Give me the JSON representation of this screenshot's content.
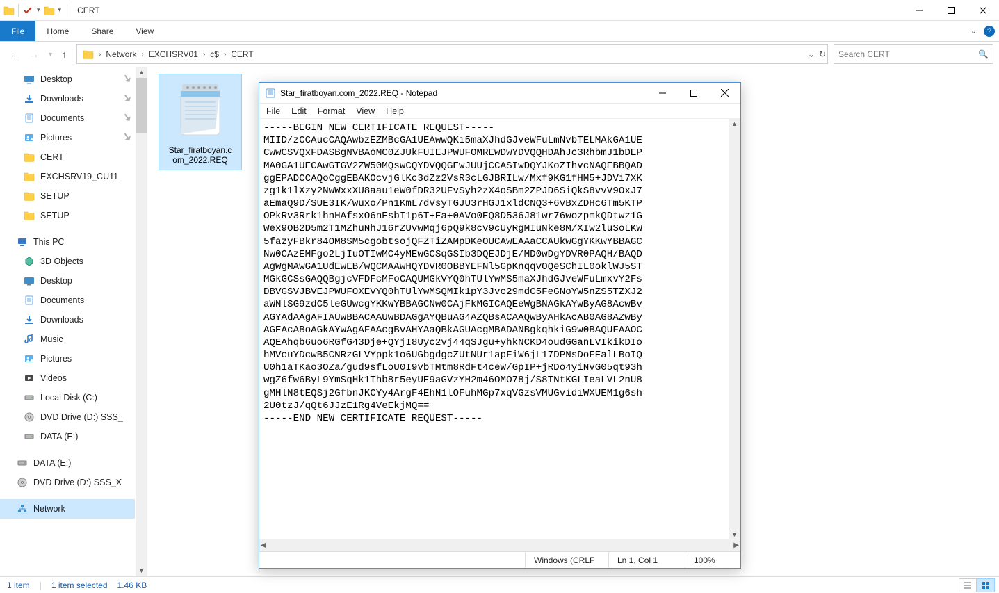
{
  "titlebar": {
    "title": "CERT"
  },
  "ribbon": {
    "file": "File",
    "home": "Home",
    "share": "Share",
    "view": "View"
  },
  "address": {
    "segments": [
      "Network",
      "EXCHSRV01",
      "c$",
      "CERT"
    ]
  },
  "search": {
    "placeholder": "Search CERT"
  },
  "nav": {
    "quick": [
      {
        "label": "Desktop",
        "icon": "desktop",
        "pin": true
      },
      {
        "label": "Downloads",
        "icon": "downloads",
        "pin": true
      },
      {
        "label": "Documents",
        "icon": "documents",
        "pin": true
      },
      {
        "label": "Pictures",
        "icon": "pictures",
        "pin": true
      },
      {
        "label": "CERT",
        "icon": "folder"
      },
      {
        "label": "EXCHSRV19_CU11",
        "icon": "folder"
      },
      {
        "label": "SETUP",
        "icon": "folder"
      },
      {
        "label": "SETUP",
        "icon": "folder"
      }
    ],
    "thispc_label": "This PC",
    "thispc": [
      {
        "label": "3D Objects",
        "icon": "3d"
      },
      {
        "label": "Desktop",
        "icon": "desktop"
      },
      {
        "label": "Documents",
        "icon": "documents"
      },
      {
        "label": "Downloads",
        "icon": "downloads"
      },
      {
        "label": "Music",
        "icon": "music"
      },
      {
        "label": "Pictures",
        "icon": "pictures"
      },
      {
        "label": "Videos",
        "icon": "videos"
      },
      {
        "label": "Local Disk (C:)",
        "icon": "drive"
      },
      {
        "label": "DVD Drive (D:) SSS_",
        "icon": "dvd"
      },
      {
        "label": "DATA (E:)",
        "icon": "drive"
      }
    ],
    "extra": [
      {
        "label": "DATA (E:)",
        "icon": "drive"
      },
      {
        "label": "DVD Drive (D:) SSS_X",
        "icon": "dvd"
      }
    ],
    "network_label": "Network"
  },
  "file": {
    "name_line1": "Star_firatboyan.c",
    "name_line2": "om_2022.REQ"
  },
  "status": {
    "count": "1 item",
    "selected": "1 item selected",
    "size": "1.46 KB"
  },
  "notepad": {
    "title": "Star_firatboyan.com_2022.REQ - Notepad",
    "menu": {
      "file": "File",
      "edit": "Edit",
      "format": "Format",
      "view": "View",
      "help": "Help"
    },
    "body": "-----BEGIN NEW CERTIFICATE REQUEST-----\nMIID/zCCAucCAQAwbzEZMBcGA1UEAwwQKi5maXJhdGJveWFuLmNvbTELMAkGA1UE\nCwwCSVQxFDASBgNVBAoMC0ZJUkFUIEJPWUFOMREwDwYDVQQHDAhJc3RhbmJ1bDEP\nMA0GA1UECAwGTGV2ZW50MQswCQYDVQQGEwJUUjCCASIwDQYJKoZIhvcNAQEBBQAD\nggEPADCCAQoCggEBAKOcvjGlKc3dZz2VsR3cLGJBRILw/Mxf9KG1fHM5+JDVi7XK\nzg1k1lXzy2NwWxxXU8aau1eW0fDR32UFvSyh2zX4oSBm2ZPJD6SiQkS8vvV9OxJ7\naEmaQ9D/SUE3IK/wuxo/Pn1KmL7dVsyTGJU3rHGJ1xldCNQ3+6vBxZDHc6Tm5KTP\nOPkRv3Rrk1hnHAfsxO6nEsbI1p6T+Ea+0AVo0EQ8D536J81wr76wozpmkQDtwz1G\nWex9OB2D5m2T1MZhuNhJ16rZUvwMqj6pQ9k8cv9cUyRgMIuNke8M/XIw2luSoLKW\n5fazyFBkr84OM8SM5cgobtsojQFZTiZAMpDKeOUCAwEAAaCCAUkwGgYKKwYBBAGC\nNw0CAzEMFgo2LjIuOTIwMC4yMEwGCSqGSIb3DQEJDjE/MD0wDgYDVR0PAQH/BAQD\nAgWgMAwGA1UdEwEB/wQCMAAwHQYDVR0OBBYEFNl5GpKnqqvOQeSChIL0oklWJ5ST\nMGkGCSsGAQQBgjcVFDFcMFoCAQUMGkVYQ0hTUlYwMS5maXJhdGJveWFuLmxvY2Fs\nDBVGSVJBVEJPWUFOXEVYQ0hTUlYwMSQMIk1pY3Jvc29mdC5FeGNoYW5nZS5TZXJ2\naWNlSG9zdC5leGUwcgYKKwYBBAGCNw0CAjFkMGICAQEeWgBNAGkAYwByAG8AcwBv\nAGYAdAAgAFIAUwBBACAAUwBDAGgAYQBuAG4AZQBsACAAQwByAHkAcAB0AG8AZwBy\nAGEAcABoAGkAYwAgAFAAcgBvAHYAaQBkAGUAcgMBADANBgkqhkiG9w0BAQUFAAOC\nAQEAhqb6uo6RGfG43Dje+QYjI8Uyc2vj44qSJgu+yhkNCKD4oudGGanLVIkikDIo\nhMVcuYDcwB5CNRzGLVYppk1o6UGbgdgcZUtNUr1apFiW6jL17DPNsDoFEalLBoIQ\nU0h1aTKao3OZa/gud9sfLoU0I9vbTMtm8RdFt4ceW/GpIP+jRDo4yiNvG05qt93h\nwgZ6fw6ByL9YmSqHk1Thb8r5eyUE9aGVzYH2m46OMO78j/S8TNtKGLIeaLVL2nU8\ngMHlN8tEQSj2GfbnJKCYy4ArgF4EhN1lOFuhMGp7xqVGzsVMUGvidiWXUEM1g6sh\n2U0tzJ/qQt6JJzE1Rg4VeEkjMQ==\n-----END NEW CERTIFICATE REQUEST-----",
    "status": {
      "encoding": "Windows (CRLF",
      "pos": "Ln 1, Col 1",
      "zoom": "100%"
    }
  }
}
